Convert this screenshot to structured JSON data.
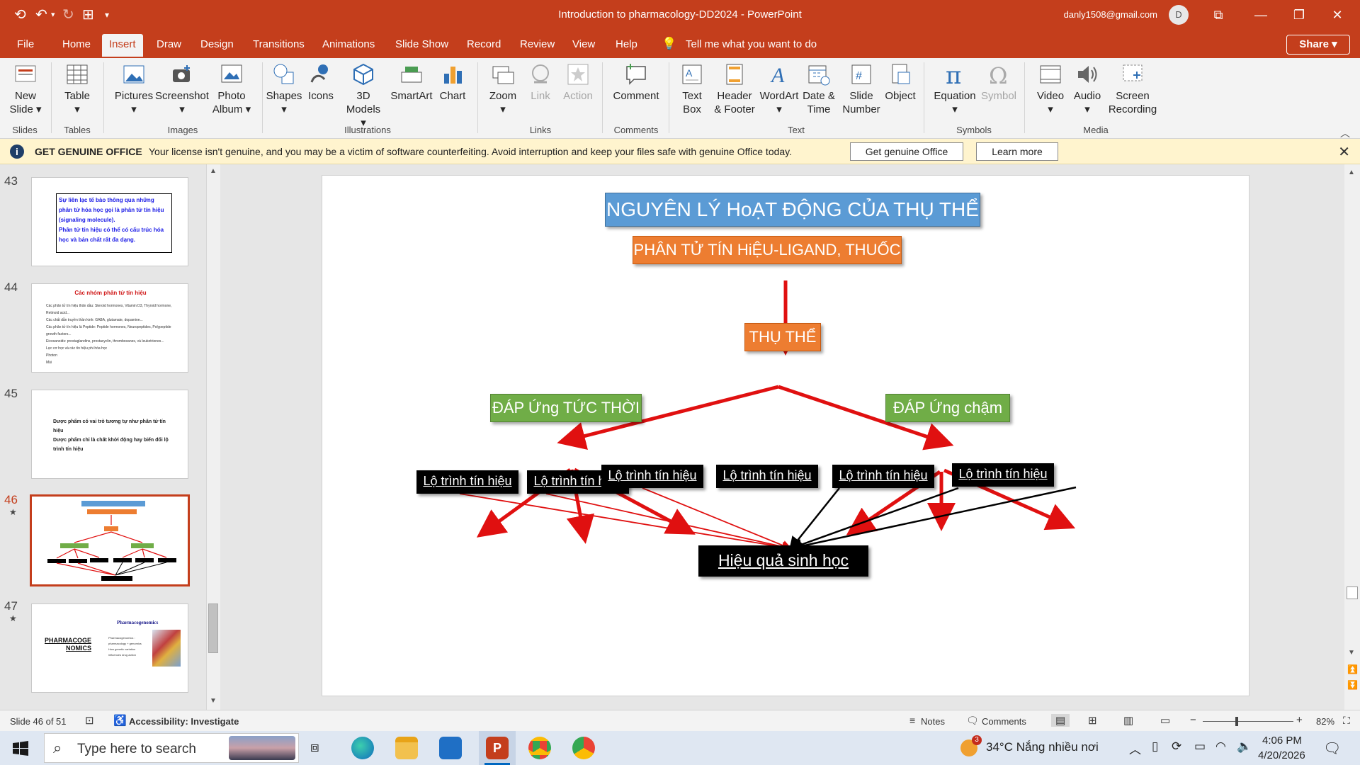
{
  "titlebar": {
    "doc_title": "Introduction to pharmacology-DD2024  -  PowerPoint",
    "account": "danly1508@gmail.com",
    "avatar_initial": "D"
  },
  "tabs": [
    "File",
    "Home",
    "Insert",
    "Draw",
    "Design",
    "Transitions",
    "Animations",
    "Slide Show",
    "Record",
    "Review",
    "View",
    "Help"
  ],
  "active_tab": "Insert",
  "tell_me": "Tell me what you want to do",
  "share_label": "Share",
  "ribbon": {
    "new_slide": "New Slide",
    "table": "Table",
    "pictures": "Pictures",
    "screenshot": "Screenshot",
    "photo_album": "Photo Album",
    "shapes": "Shapes",
    "icons": "Icons",
    "models_3d": "3D Models",
    "smartart": "SmartArt",
    "chart": "Chart",
    "zoom": "Zoom",
    "link": "Link",
    "action": "Action",
    "comment": "Comment",
    "text_box": "Text Box",
    "header_footer": "Header & Footer",
    "wordart": "WordArt",
    "date_time": "Date & Time",
    "slide_number": "Slide Number",
    "object": "Object",
    "equation": "Equation",
    "symbol": "Symbol",
    "video": "Video",
    "audio": "Audio",
    "screen_recording": "Screen Recording",
    "groups": {
      "slides": "Slides",
      "tables": "Tables",
      "images": "Images",
      "illustrations": "Illustrations",
      "links": "Links",
      "comments": "Comments",
      "text": "Text",
      "symbols": "Symbols",
      "media": "Media"
    }
  },
  "license_bar": {
    "title": "GET GENUINE OFFICE",
    "message": "Your license isn't genuine, and you may be a victim of software counterfeiting. Avoid interruption and keep your files safe with genuine Office today.",
    "btn_genuine": "Get genuine Office",
    "btn_learn": "Learn more"
  },
  "thumbnails": [
    {
      "num": "43",
      "star": "",
      "lines": [
        "Sự liên lạc tế bào thông qua những phân tử hóa học gọi là phân tử tín hiệu (signaling molecule).",
        "Phân tử tín hiệu có thể có cấu trúc hóa học và bản chất rất đa dạng."
      ]
    },
    {
      "num": "44",
      "star": "",
      "title": "Các nhóm phân tử tín hiệu",
      "lines": [
        "Các phân tử tín hiệu thân dầu: Steroid hormones, Vitamin D3, Thyroid hormone, Retinoid acid...",
        "Các chất dẫn truyền thần kinh: GABA, glutamate, dopamine...",
        "Các phân tử tín hiệu là Peptide: Peptide hormones, Neuropeptides, Polypeptide growth factors...",
        "Eicosanoids: prostaglandins, prostacyclin, thromboxanes, và leukotrienes...",
        "Lực cơ học và các tín hiệu phi hóa học",
        "Photon",
        "Mùi"
      ]
    },
    {
      "num": "45",
      "star": "",
      "lines": [
        "Dược phẩm có vai trò tương tự như phân tử tín hiệu",
        "Dược phẩm chỉ là chất khởi động hay biến đổi lộ trình tín hiệu"
      ]
    },
    {
      "num": "46",
      "star": "★",
      "lines": []
    },
    {
      "num": "47",
      "star": "★",
      "title": "Pharmacogenomics",
      "left_text": "PHARMACOGE NOMICS",
      "lines": [
        "Pharmacogenomics : pharmacology + genomics",
        "How genetic variation influences drug action"
      ]
    }
  ],
  "slide": {
    "title": "NGUYÊN LÝ HoẠT ĐỘNG CỦA THỤ THỂ",
    "ligand": "PHÂN TỬ TÍN HiỆU-LIGAND, THUỐC",
    "receptor": "THỤ THỂ",
    "fast_response": "ĐÁP Ứng TỨC THỜI",
    "slow_response": "ĐÁP Ứng chậm",
    "pathway": "Lộ trình tín hiệu",
    "effect": "Hiệu quả sinh học"
  },
  "statusbar": {
    "slide_info": "Slide 46 of 51",
    "accessibility": "Accessibility: Investigate",
    "notes": "Notes",
    "comments": "Comments",
    "zoom": "82%"
  },
  "taskbar": {
    "search_placeholder": "Type here to search",
    "weather": "34°C  Nắng nhiều nơi",
    "time": "4:06 PM",
    "date": "4/20/2026",
    "badge": "3"
  }
}
